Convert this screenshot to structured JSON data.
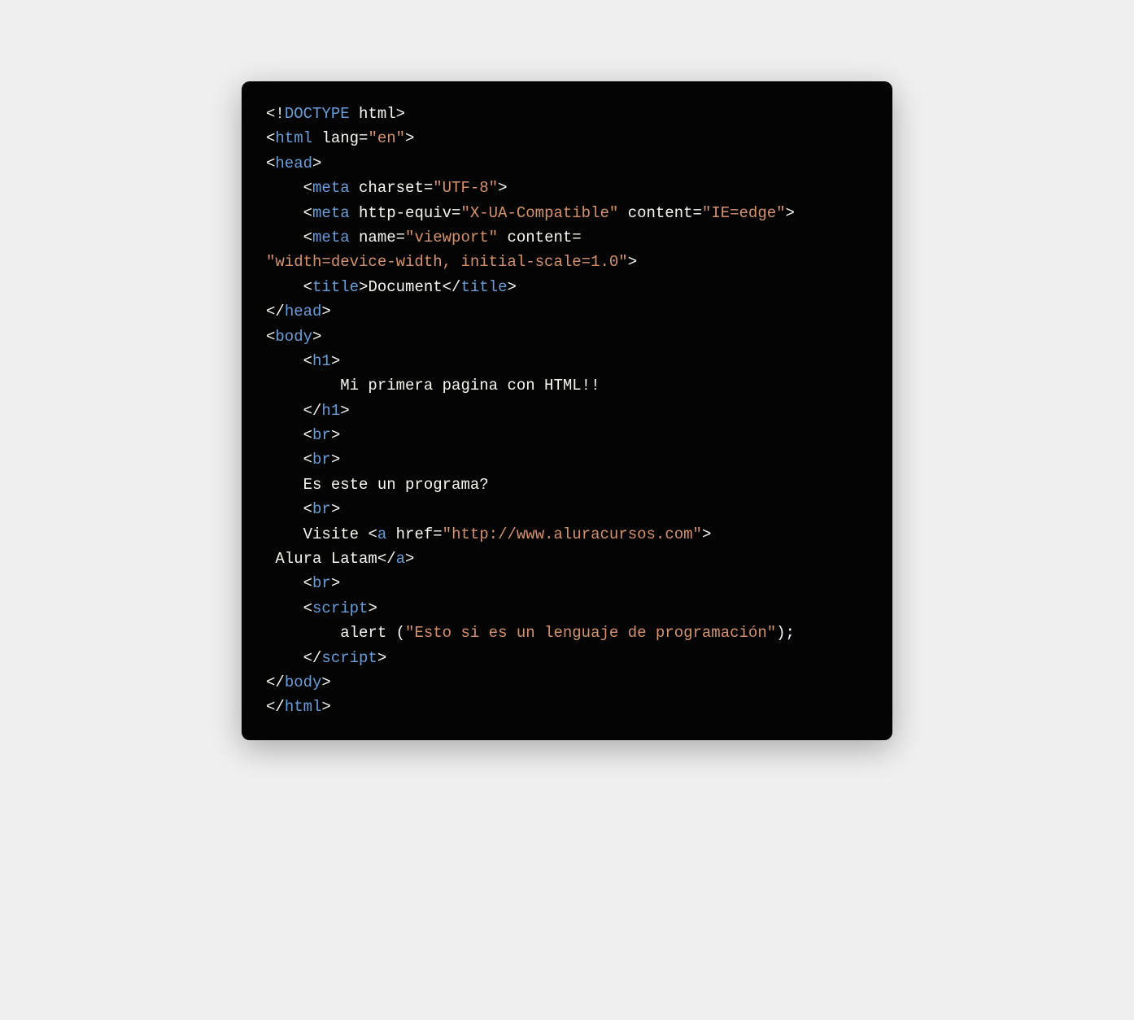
{
  "code": {
    "line1": {
      "open": "<!",
      "doctype": "DOCTYPE",
      "space": " ",
      "html": "html",
      "close": ">"
    },
    "line2": {
      "open": "<",
      "tag": "html",
      "attr": " lang",
      "eq": "=",
      "val": "\"en\"",
      "close": ">"
    },
    "line3": {
      "open": "<",
      "tag": "head",
      "close": ">"
    },
    "line4": {
      "indent": "    ",
      "open": "<",
      "tag": "meta",
      "attr": " charset",
      "eq": "=",
      "val": "\"UTF-8\"",
      "close": ">"
    },
    "line5": {
      "indent": "    ",
      "open": "<",
      "tag": "meta",
      "attr1": " http-equiv",
      "eq1": "=",
      "val1": "\"X-UA-Compatible\"",
      "attr2": " content",
      "eq2": "=",
      "val2": "\"IE=edge\"",
      "close": ">"
    },
    "line6": {
      "indent": "    ",
      "open": "<",
      "tag": "meta",
      "attr1": " name",
      "eq1": "=",
      "val1": "\"viewport\"",
      "attr2": " content",
      "eq2": "="
    },
    "line7": {
      "val": "\"width=device-width, initial-scale=1.0\"",
      "close": ">"
    },
    "line8": {
      "indent": "    ",
      "open": "<",
      "tag": "title",
      "close": ">",
      "text": "Document",
      "open2": "</",
      "tag2": "title",
      "close2": ">"
    },
    "line9": {
      "open": "</",
      "tag": "head",
      "close": ">"
    },
    "line10": {
      "open": "<",
      "tag": "body",
      "close": ">"
    },
    "line11": {
      "indent": "    ",
      "open": "<",
      "tag": "h1",
      "close": ">"
    },
    "line12": {
      "indent": "        ",
      "text": "Mi primera pagina con HTML!!"
    },
    "line13": {
      "indent": "    ",
      "open": "</",
      "tag": "h1",
      "close": ">"
    },
    "line14": {
      "indent": "    ",
      "open": "<",
      "tag": "br",
      "close": ">"
    },
    "line15": {
      "indent": "    ",
      "open": "<",
      "tag": "br",
      "close": ">"
    },
    "line16": {
      "indent": "    ",
      "text": "Es este un programa?"
    },
    "line17": {
      "indent": "    ",
      "open": "<",
      "tag": "br",
      "close": ">"
    },
    "line18": {
      "indent": "    ",
      "text": "Visite ",
      "open": "<",
      "tag": "a",
      "attr": " href",
      "eq": "=",
      "val": "\"http://www.aluracursos.com\"",
      "close": ">"
    },
    "line19": {
      "text": " Alura Latam",
      "open": "</",
      "tag": "a",
      "close": ">"
    },
    "line20": {
      "indent": "    ",
      "open": "<",
      "tag": "br",
      "close": ">"
    },
    "line21": {
      "indent": "    ",
      "open": "<",
      "tag": "script",
      "close": ">"
    },
    "line22": {
      "indent": "        ",
      "func": "alert ",
      "paren1": "(",
      "str": "\"Esto si es un lenguaje de programación\"",
      "paren2": ");"
    },
    "line23": {
      "indent": "    ",
      "open": "</",
      "tag": "script",
      "close": ">"
    },
    "line24": {
      "open": "</",
      "tag": "body",
      "close": ">"
    },
    "line25": {
      "open": "</",
      "tag": "html",
      "close": ">"
    }
  }
}
